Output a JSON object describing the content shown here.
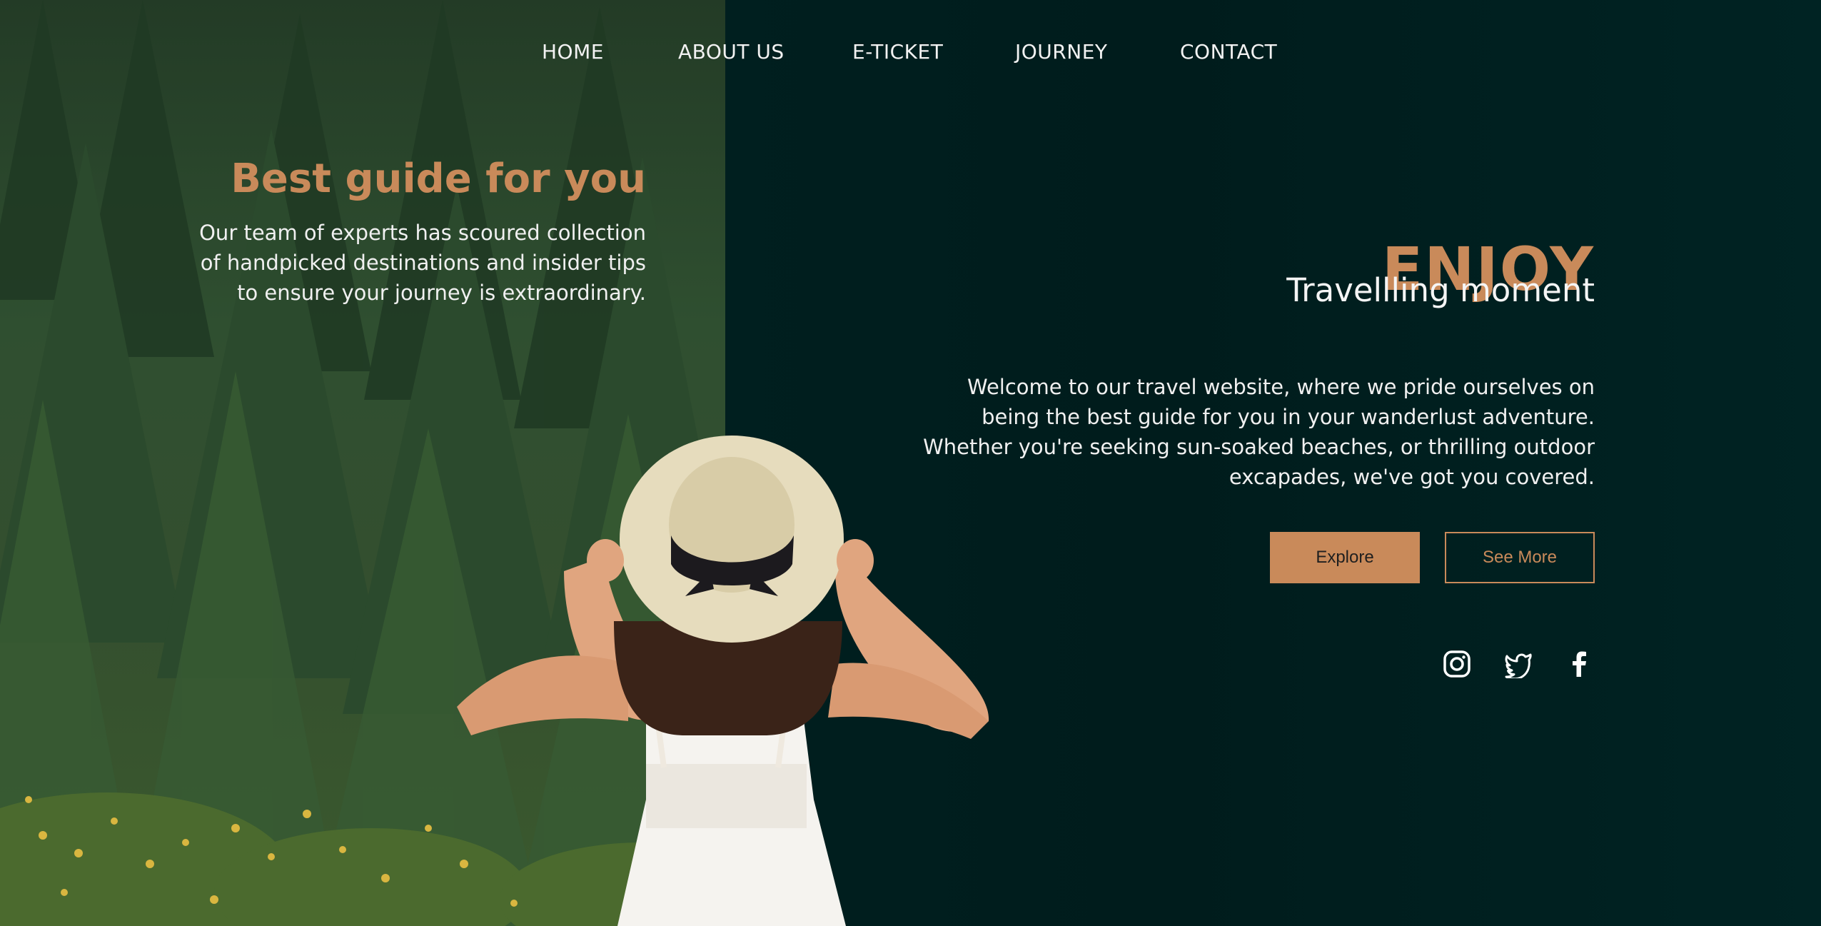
{
  "nav": {
    "items": [
      {
        "label": "HOME"
      },
      {
        "label": "ABOUT US"
      },
      {
        "label": "E-TICKET"
      },
      {
        "label": "JOURNEY"
      },
      {
        "label": "CONTACT"
      }
    ]
  },
  "left_panel": {
    "title": "Best guide for you",
    "description": "Our team of experts has scoured collection of handpicked destinations and insider tips to ensure your journey is extraordinary."
  },
  "hero": {
    "title": "ENJOY",
    "subtitle": "Travellling moment",
    "description": "Welcome to our travel website, where we pride ourselves on being the best guide for you in your wanderlust adventure. Whether you're seeking sun-soaked beaches, or thrilling outdoor excapades, we've got you covered."
  },
  "buttons": {
    "explore": "Explore",
    "see_more": "See More"
  },
  "social": [
    "instagram-icon",
    "twitter-icon",
    "facebook-icon"
  ],
  "colors": {
    "accent": "#c98a5a",
    "background": "#001e1e",
    "forest": "#2f4f30",
    "text": "#f0f0f0"
  }
}
